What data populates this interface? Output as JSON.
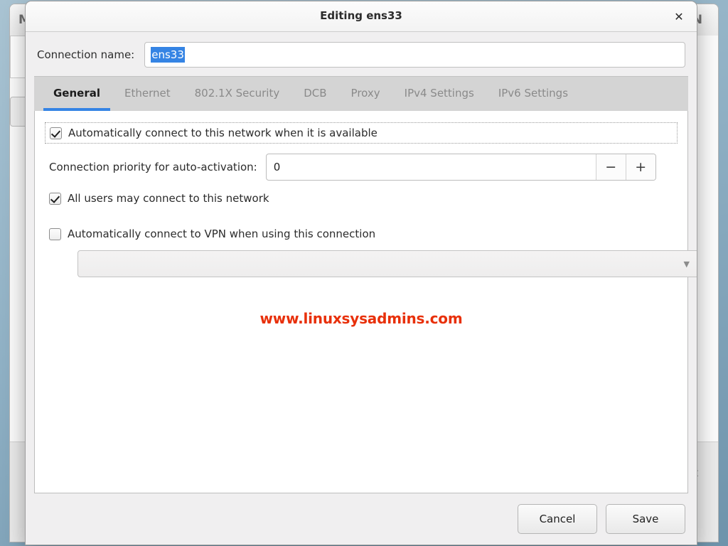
{
  "background": {
    "title_left": "M",
    "title_right": "N",
    "text_right": "t"
  },
  "dialog": {
    "title": "Editing ens33",
    "close_icon": "✕",
    "connection_name": {
      "label": "Connection name:",
      "value": "ens33"
    },
    "tabs": [
      {
        "label": "General",
        "active": true
      },
      {
        "label": "Ethernet",
        "active": false
      },
      {
        "label": "802.1X Security",
        "active": false
      },
      {
        "label": "DCB",
        "active": false
      },
      {
        "label": "Proxy",
        "active": false
      },
      {
        "label": "IPv4 Settings",
        "active": false
      },
      {
        "label": "IPv6 Settings",
        "active": false
      }
    ],
    "general": {
      "auto_connect_label": "Automatically connect to this network when it is available",
      "auto_connect_checked": true,
      "priority_label": "Connection priority for auto-activation:",
      "priority_value": "0",
      "spin_decrement": "−",
      "spin_increment": "+",
      "all_users_label": "All users may connect to this network",
      "all_users_checked": true,
      "vpn_label": "Automatically connect to VPN when using this connection",
      "vpn_checked": false,
      "vpn_combo_value": "",
      "vpn_combo_arrow": "▼"
    },
    "watermark": "www.linuxsysadmins.com",
    "footer": {
      "cancel_label": "Cancel",
      "save_label": "Save"
    }
  },
  "colors": {
    "accent": "#3584e4",
    "watermark": "#e8300a",
    "selection": "#3584e4"
  }
}
